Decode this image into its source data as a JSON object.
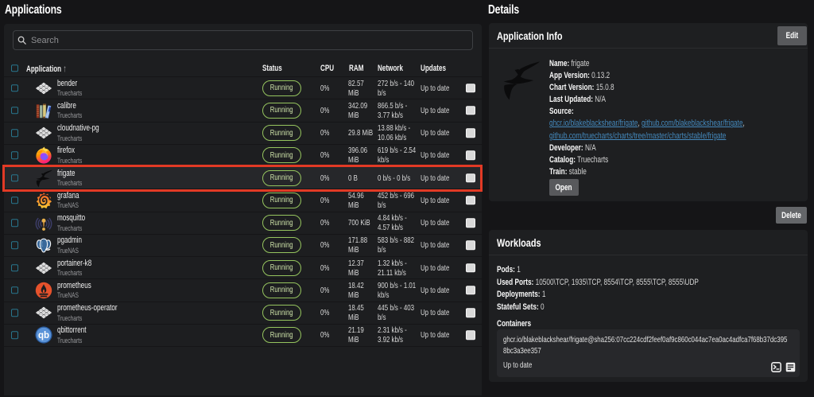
{
  "left_panel": {
    "title": "Applications",
    "search": {
      "placeholder": "Search",
      "value": ""
    },
    "table": {
      "headers": {
        "application": "Application",
        "status": "Status",
        "cpu": "CPU",
        "ram": "RAM",
        "network": "Network",
        "updates": "Updates"
      },
      "sort": {
        "column": "Application",
        "direction": "asc"
      },
      "rows": [
        {
          "name": "bender",
          "catalog": "Truecharts",
          "icon": "truecharts-icon",
          "status": "Running",
          "cpu": "0%",
          "ram": "82.57\nMiB",
          "network": "272 b/s - 140\nb/s",
          "updates": "Up to date",
          "highlighted": false
        },
        {
          "name": "calibre",
          "catalog": "Truecharts",
          "icon": "calibre-icon",
          "status": "Running",
          "cpu": "0%",
          "ram": "342.09\nMiB",
          "network": "866.5 b/s -\n3.77 kb/s",
          "updates": "Up to date",
          "highlighted": false
        },
        {
          "name": "cloudnative-pg",
          "catalog": "Truecharts",
          "icon": "truecharts-icon",
          "status": "Running",
          "cpu": "0%",
          "ram": "29.8 MiB",
          "network": "13.88 kb/s -\n10.06 kb/s",
          "updates": "Up to date",
          "highlighted": false
        },
        {
          "name": "firefox",
          "catalog": "Truecharts",
          "icon": "firefox-icon",
          "status": "Running",
          "cpu": "0%",
          "ram": "396.06\nMiB",
          "network": "619 b/s - 2.54\nkb/s",
          "updates": "Up to date",
          "highlighted": false
        },
        {
          "name": "frigate",
          "catalog": "Truecharts",
          "icon": "frigate-icon",
          "status": "Running",
          "cpu": "0%",
          "ram": "0 B",
          "network": "0 b/s - 0 b/s",
          "updates": "Up to date",
          "highlighted": true
        },
        {
          "name": "grafana",
          "catalog": "TrueNAS",
          "icon": "grafana-icon",
          "status": "Running",
          "cpu": "0%",
          "ram": "54.96\nMiB",
          "network": "452 b/s - 696\nb/s",
          "updates": "Up to date",
          "highlighted": false
        },
        {
          "name": "mosquitto",
          "catalog": "Truecharts",
          "icon": "mosquitto-icon",
          "status": "Running",
          "cpu": "0%",
          "ram": "700 KiB",
          "network": "4.84 kb/s -\n4.57 kb/s",
          "updates": "Up to date",
          "highlighted": false
        },
        {
          "name": "pgadmin",
          "catalog": "TrueNAS",
          "icon": "pgadmin-icon",
          "status": "Running",
          "cpu": "0%",
          "ram": "171.88\nMiB",
          "network": "583 b/s - 882\nb/s",
          "updates": "Up to date",
          "highlighted": false
        },
        {
          "name": "portainer-k8",
          "catalog": "Truecharts",
          "icon": "truecharts-icon",
          "status": "Running",
          "cpu": "0%",
          "ram": "12.37\nMiB",
          "network": "1.32 kb/s -\n21.11 kb/s",
          "updates": "Up to date",
          "highlighted": false
        },
        {
          "name": "prometheus",
          "catalog": "TrueNAS",
          "icon": "prometheus-icon",
          "status": "Running",
          "cpu": "0%",
          "ram": "18.42\nMiB",
          "network": "900 b/s - 1.01\nkb/s",
          "updates": "Up to date",
          "highlighted": false
        },
        {
          "name": "prometheus-operator",
          "catalog": "Truecharts",
          "icon": "truecharts-icon",
          "status": "Running",
          "cpu": "0%",
          "ram": "18.45\nMiB",
          "network": "445 b/s - 403\nb/s",
          "updates": "Up to date",
          "highlighted": false
        },
        {
          "name": "qbittorrent",
          "catalog": "Truecharts",
          "icon": "qbittorrent-icon",
          "status": "Running",
          "cpu": "0%",
          "ram": "21.19\nMiB",
          "network": "2.31 kb/s -\n3.92 kb/s",
          "updates": "Up to date",
          "highlighted": false
        }
      ]
    }
  },
  "details_panel": {
    "title": "Details",
    "application_info": {
      "title": "Application Info",
      "edit_label": "Edit",
      "logo_icon": "frigate-logo",
      "fields": [
        {
          "label": "Name:",
          "value": "frigate"
        },
        {
          "label": "App Version:",
          "value": "0.13.2"
        },
        {
          "label": "Chart Version:",
          "value": "15.0.8"
        },
        {
          "label": "Last Updated:",
          "value": "N/A"
        },
        {
          "label": "Source:",
          "links": [
            "ghcr.io/blakeblackshear/frigate",
            "github.com/blakeblackshear/frigate",
            "github.com/truecharts/charts/tree/master/charts/stable/frigate"
          ]
        },
        {
          "label": "Developer:",
          "value": "N/A"
        },
        {
          "label": "Catalog:",
          "value": "Truecharts"
        },
        {
          "label": "Train:",
          "value": "stable"
        }
      ],
      "open_label": "Open"
    },
    "delete_label": "Delete",
    "workloads": {
      "title": "Workloads",
      "fields": [
        {
          "label": "Pods:",
          "value": "1"
        },
        {
          "label": "Used Ports:",
          "value": "10500\\TCP, 1935\\TCP, 8554\\TCP, 8555\\TCP, 8555\\UDP"
        },
        {
          "label": "Deployments:",
          "value": "1"
        },
        {
          "label": "Stateful Sets:",
          "value": "0"
        }
      ],
      "containers_label": "Containers",
      "container": {
        "image": "ghcr.io/blakeblackshear/frigate@sha256:07cc224cdf2feef0af9c860c044ac7ea0ac4adfca7f68b37dc395\n8bc3a3ee357",
        "status": "Up to date",
        "actions": [
          "shell",
          "logs"
        ]
      }
    }
  },
  "colors": {
    "accent_green": "#95c45e",
    "checkbox_teal": "#2d7f96",
    "link_blue": "#4a8fc7",
    "highlight_red": "#e23a25",
    "card_bg": "#1e1f21",
    "page_bg": "#121214"
  }
}
